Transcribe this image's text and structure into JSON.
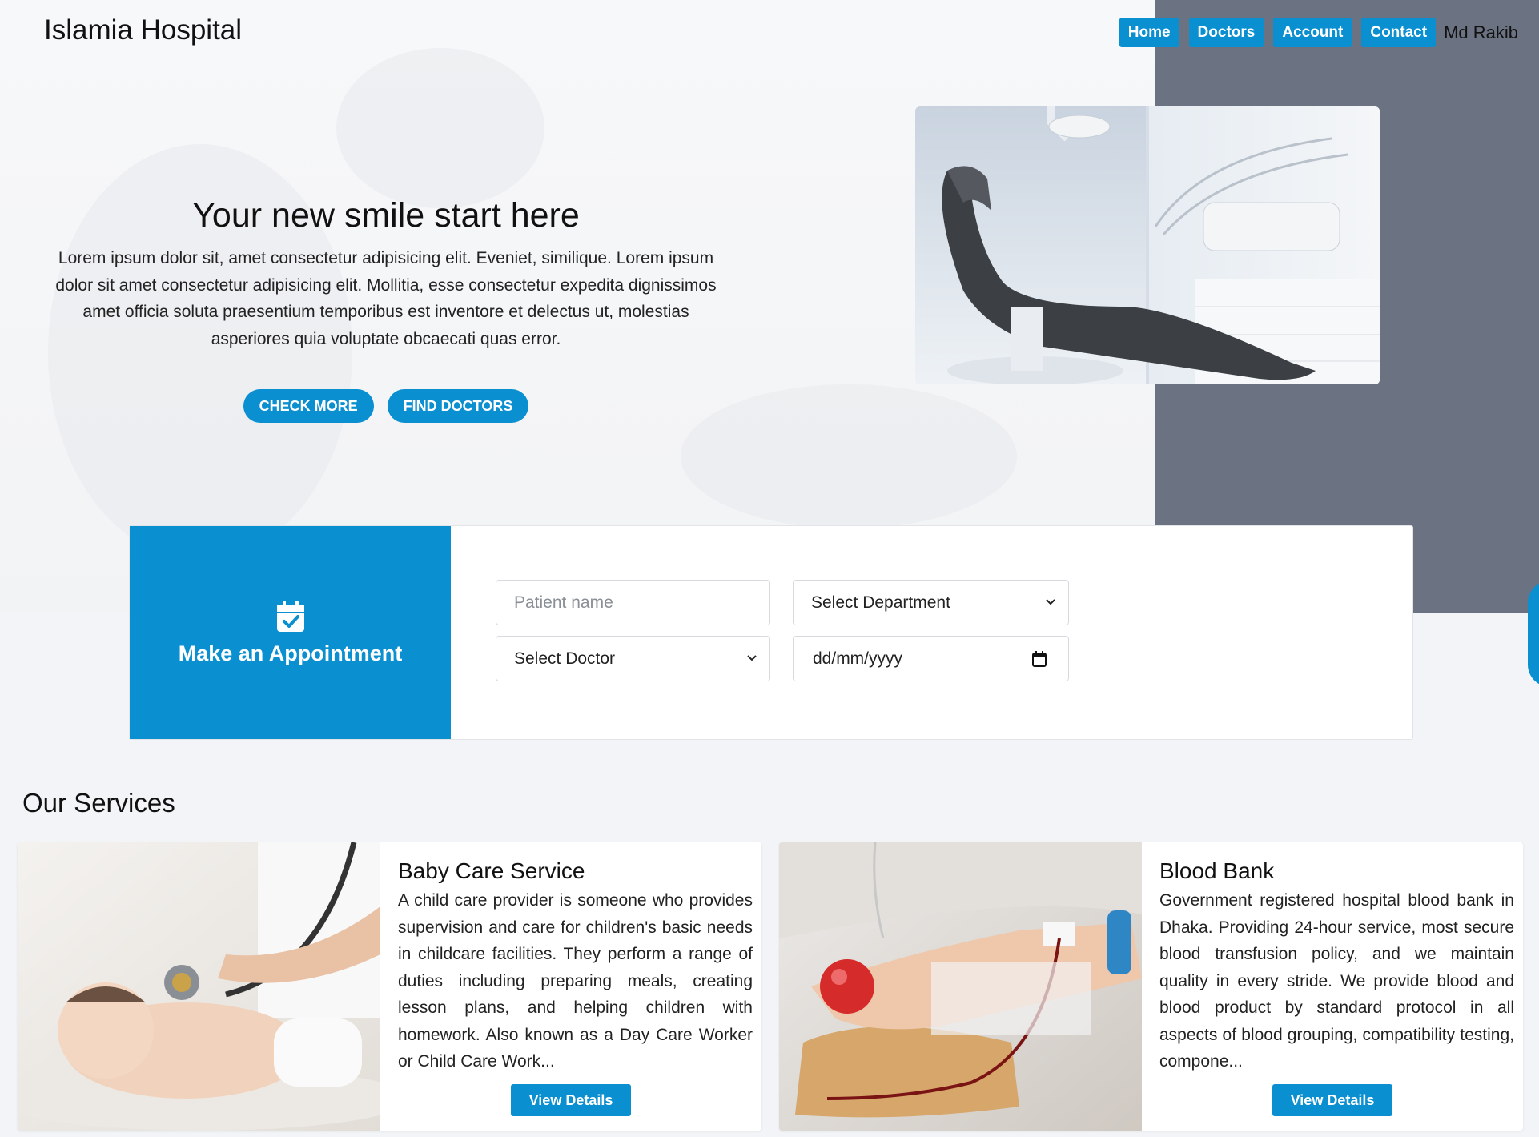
{
  "brand": {
    "name": "Islamia Hospital"
  },
  "nav": {
    "items": [
      {
        "label": "Home"
      },
      {
        "label": "Doctors"
      },
      {
        "label": "Account"
      },
      {
        "label": "Contact"
      }
    ],
    "user_name": "Md Rakib"
  },
  "hero": {
    "title": "Your new smile start here",
    "description": "Lorem ipsum dolor sit, amet consectetur adipisicing elit. Eveniet, similique. Lorem ipsum dolor sit amet consectetur adipisicing elit. Mollitia, esse consectetur expedita dignissimos amet officia soluta praesentium temporibus est inventore et delectus ut, molestias asperiores quia voluptate obcaecati quas error.",
    "check_more_label": "CHECK MORE",
    "find_doctors_label": "FIND DOCTORS",
    "image_alt": "dental-chair-photo"
  },
  "appointment": {
    "title": "Make an Appointment",
    "patient_placeholder": "Patient name",
    "department_selected": "Select Department",
    "doctor_selected": "Select Doctor",
    "date_placeholder": "dd/mm/yyyy",
    "submit_icon": "paper-plane-icon"
  },
  "services": {
    "title": "Our Services",
    "cards": [
      {
        "title": "Baby Care Service",
        "text": "A child care provider is someone who provides supervision and care for children's basic needs in childcare facilities. They perform a range of duties including preparing meals, creating lesson plans, and helping children with homework. Also known as a Day Care Worker or Child Care Work...",
        "button_label": "View Details"
      },
      {
        "title": "Blood Bank",
        "text": "Government registered hospital blood bank in Dhaka. Providing 24-hour service, most secure blood transfusion policy, and we maintain quality in every stride. We provide blood and blood product by standard protocol in all aspects of blood grouping, compatibility testing, compone...",
        "button_label": "View Details"
      }
    ]
  },
  "colors": {
    "accent": "#0a8fd0",
    "side_panel": "#6b7281",
    "page_bg": "#f3f4f7"
  }
}
